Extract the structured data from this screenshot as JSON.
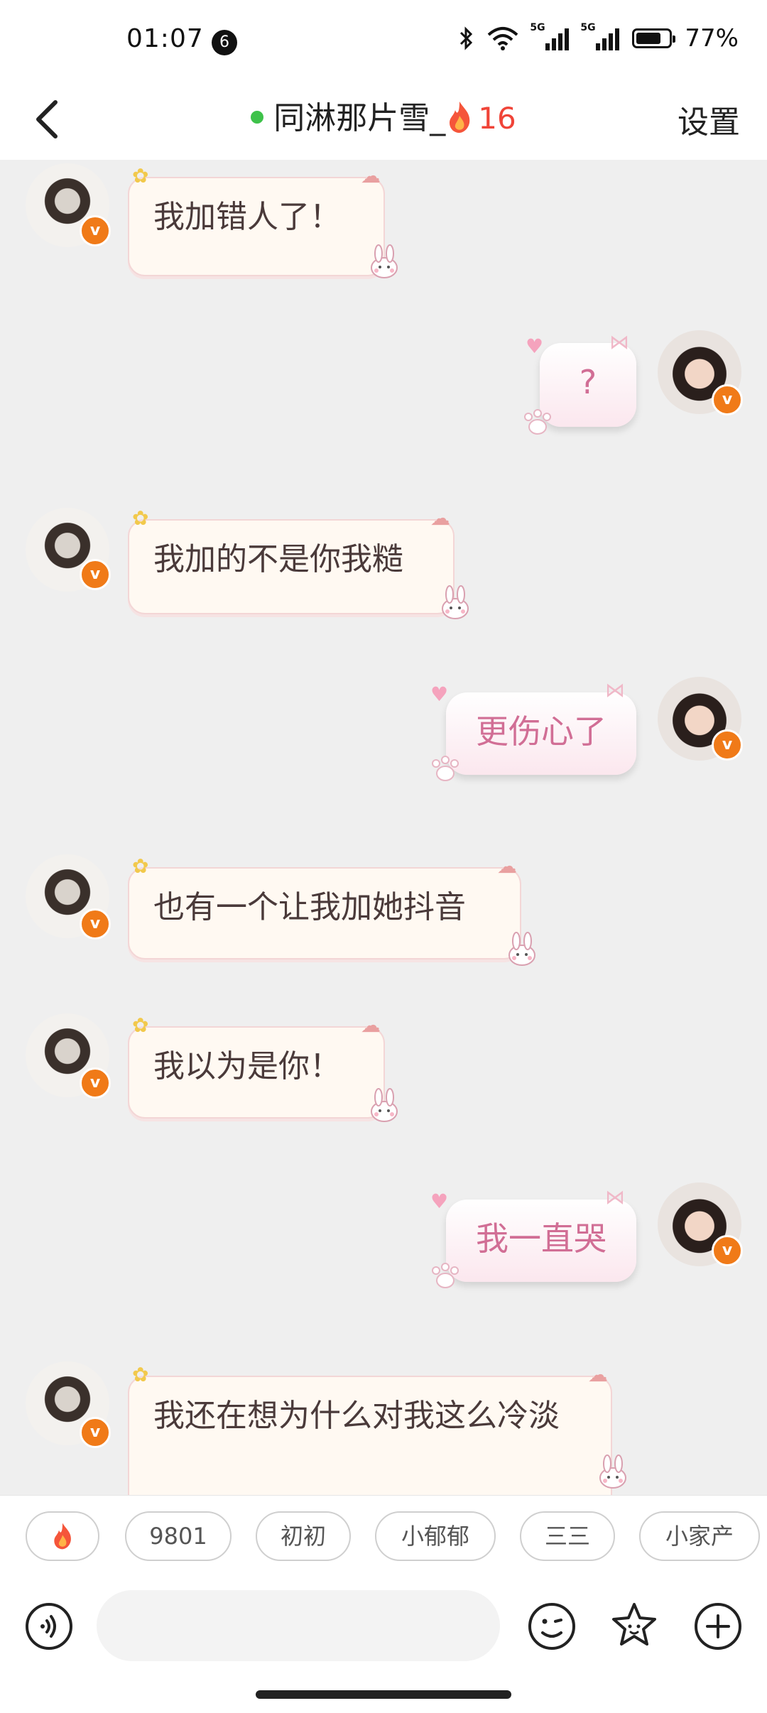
{
  "status_bar": {
    "time": "01:07",
    "notification_count": "6",
    "battery_percent": "77%",
    "battery_level": 0.77,
    "network_1": "5G",
    "network_2": "5G"
  },
  "header": {
    "title": "同淋那片雪_",
    "streak_count": "16",
    "settings_label": "设置",
    "online_color": "#3ec24a",
    "streak_color": "#f04438"
  },
  "messages": [
    {
      "side": "left",
      "text": "我加错人了！"
    },
    {
      "side": "right",
      "text": "?"
    },
    {
      "side": "left",
      "text": "我加的不是你我糙"
    },
    {
      "side": "right",
      "text": "更伤心了"
    },
    {
      "side": "left",
      "text": "也有一个让我加她抖音"
    },
    {
      "side": "left",
      "text": "我以为是你！"
    },
    {
      "side": "right",
      "text": "我一直哭"
    },
    {
      "side": "left",
      "text": "我还在想为什么对我这么冷淡"
    }
  ],
  "quick_chips": [
    "9801",
    "初初",
    "小郁郁",
    "三三",
    "小家产"
  ],
  "icons": {
    "back": "chevron-left-icon",
    "voice": "voice-icon",
    "emoji": "emoji-icon",
    "sticker": "star-sticker-icon",
    "add": "plus-circle-icon",
    "fire": "fire-icon",
    "verified": "verified-badge-icon"
  },
  "colors": {
    "badge": "#f07a18",
    "right_bubble_text": "#d16e95",
    "left_bubble_bg": "#fff9f2"
  }
}
